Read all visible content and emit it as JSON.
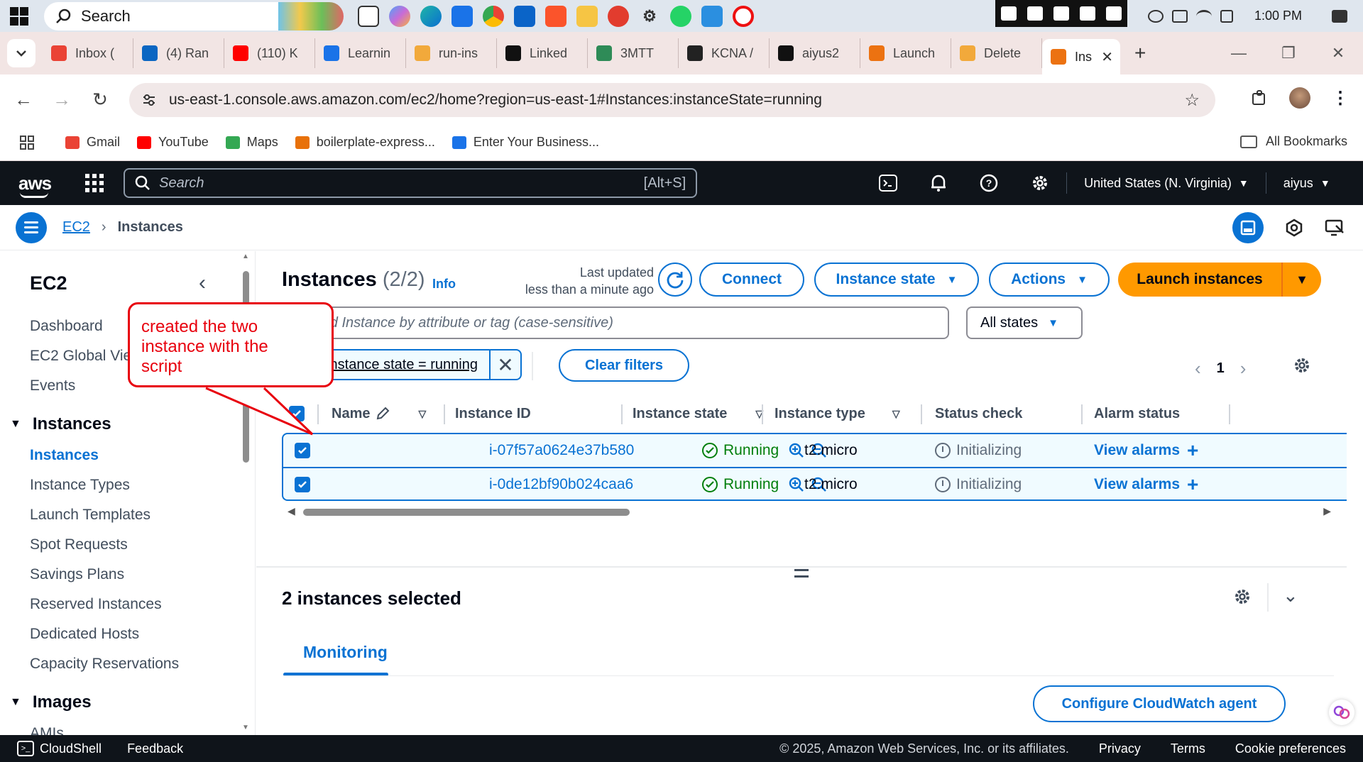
{
  "taskbar": {
    "search_placeholder": "Search",
    "clock": "1:00 PM"
  },
  "tabs": [
    {
      "label": "Inbox (",
      "icon": "gmail-icon",
      "color": "#ea4335"
    },
    {
      "label": "(4) Ran",
      "icon": "linkedin-icon",
      "color": "#0a66c2"
    },
    {
      "label": "(110) K",
      "icon": "youtube-icon",
      "color": "#ff0000"
    },
    {
      "label": "Learnin",
      "icon": "learning-icon",
      "color": "#1a73e8"
    },
    {
      "label": "run-ins",
      "icon": "doc-icon",
      "color": "#f2a93b"
    },
    {
      "label": "Linked",
      "icon": "chatgpt-icon",
      "color": "#111111"
    },
    {
      "label": "3MTT",
      "icon": "3mtt-icon",
      "color": "#2e8b57"
    },
    {
      "label": "KCNA /",
      "icon": "kcna-icon",
      "color": "#222222"
    },
    {
      "label": "aiyus2",
      "icon": "github-icon",
      "color": "#111111"
    },
    {
      "label": "Launch",
      "icon": "aws-tab-icon",
      "color": "#ec7211"
    },
    {
      "label": "Delete",
      "icon": "doc-icon",
      "color": "#f2a93b"
    }
  ],
  "active_tab": {
    "label": "Ins",
    "color": "#ec7211"
  },
  "address": {
    "url": "us-east-1.console.aws.amazon.com/ec2/home?region=us-east-1#Instances:instanceState=running"
  },
  "bookmarks": [
    {
      "label": "Gmail",
      "color": "#ea4335"
    },
    {
      "label": "YouTube",
      "color": "#ff0000"
    },
    {
      "label": "Maps",
      "color": "#34a853"
    },
    {
      "label": "boilerplate-express...",
      "color": "#e8710a"
    },
    {
      "label": "Enter Your Business...",
      "color": "#1a73e8"
    }
  ],
  "bookmarks_all": "All Bookmarks",
  "aws_nav": {
    "logo": "aws",
    "search_placeholder": "Search",
    "search_shortcut": "[Alt+S]",
    "region": "United States (N. Virginia)",
    "user": "aiyus"
  },
  "breadcrumb": {
    "service": "EC2",
    "current": "Instances"
  },
  "sidebar": {
    "title": "EC2",
    "top_items": [
      "Dashboard",
      "EC2 Global View",
      "Events"
    ],
    "instances_section": "Instances",
    "instances_items": [
      "Instances",
      "Instance Types",
      "Launch Templates",
      "Spot Requests",
      "Savings Plans",
      "Reserved Instances",
      "Dedicated Hosts",
      "Capacity Reservations"
    ],
    "images_section": "Images",
    "images_items": [
      "AMIs"
    ]
  },
  "main": {
    "title": "Instances",
    "count": "(2/2)",
    "info": "Info",
    "last_updated_label": "Last updated",
    "last_updated_value": "less than a minute ago",
    "connect_button": "Connect",
    "instance_state_button": "Instance state",
    "actions_button": "Actions",
    "launch_button": "Launch instances",
    "search_placeholder": "Find Instance by attribute or tag (case-sensitive)",
    "states_select": "All states",
    "filter_token": "Instance state = running",
    "clear_filters": "Clear filters",
    "page_number": "1",
    "columns": [
      "Name",
      "Instance ID",
      "Instance state",
      "Instance type",
      "Status check",
      "Alarm status"
    ],
    "rows": [
      {
        "name": "",
        "id": "i-07f57a0624e37b580",
        "state": "Running",
        "type": "t2.micro",
        "status": "Initializing",
        "alarm": "View alarms",
        "selected": true
      },
      {
        "name": "",
        "id": "i-0de12bf90b024caa6",
        "state": "Running",
        "type": "t2.micro",
        "status": "Initializing",
        "alarm": "View alarms",
        "selected": true
      }
    ]
  },
  "split_panel": {
    "title": "2 instances selected",
    "tab": "Monitoring",
    "cloudwatch_button": "Configure CloudWatch agent"
  },
  "annotation": {
    "line1": "created the two",
    "line2": "instance with the",
    "line3": "script",
    "color": "#e8000d"
  },
  "footer": {
    "cloudshell": "CloudShell",
    "feedback": "Feedback",
    "copyright": "© 2025, Amazon Web Services, Inc. or its affiliates.",
    "privacy": "Privacy",
    "terms": "Terms",
    "cookies": "Cookie preferences"
  },
  "colors": {
    "aws_blue": "#0972d3",
    "aws_orange": "#ff9900",
    "running_green": "#037f0c",
    "nav_dark": "#0f141a"
  }
}
